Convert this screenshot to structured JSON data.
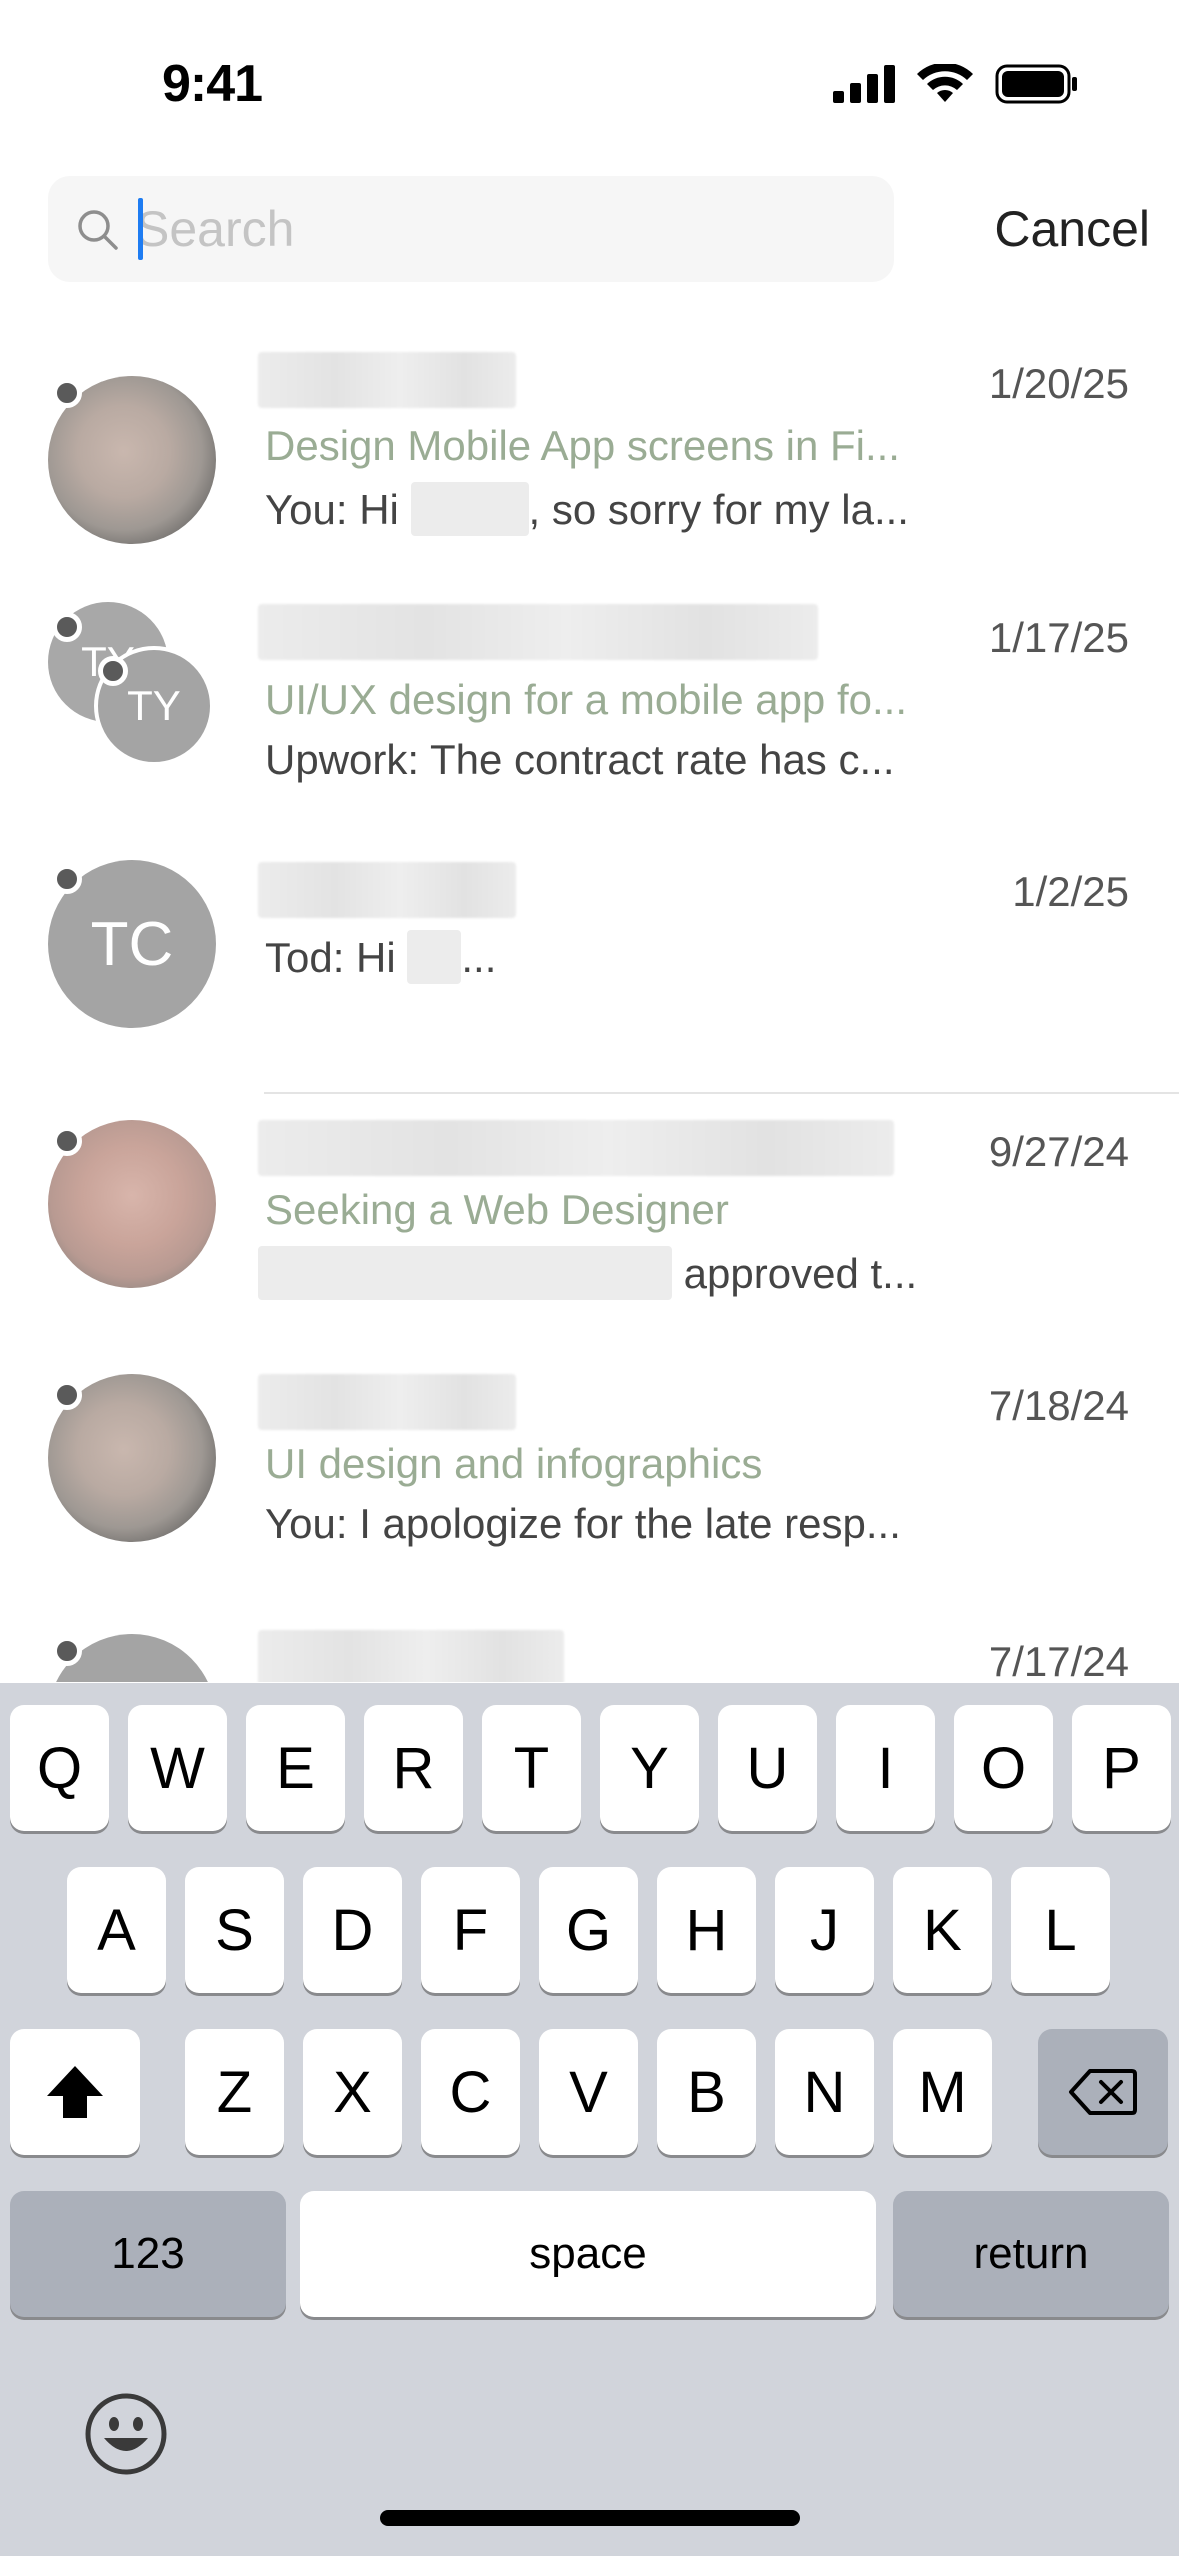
{
  "status_bar": {
    "time": "9:41"
  },
  "search": {
    "placeholder": "Search",
    "value": "",
    "cancel_label": "Cancel"
  },
  "conversations": [
    {
      "date": "1/20/25",
      "job_title": "Design Mobile App screens in Fi...",
      "preview_prefix": "You: Hi",
      "preview_suffix": ", so sorry for my la..."
    },
    {
      "date": "1/17/25",
      "avatar_initials_back": "TY",
      "avatar_initials_front": "TY",
      "job_title": "UI/UX design for a mobile app fo...",
      "preview": "Upwork: The contract rate has c..."
    },
    {
      "date": "1/2/25",
      "avatar_initials": "TC",
      "preview_prefix": "Tod: Hi",
      "preview_suffix": "..."
    },
    {
      "date": "9/27/24",
      "job_title": "Seeking a Web Designer",
      "preview_suffix": "approved t..."
    },
    {
      "date": "7/18/24",
      "job_title": "UI design and infographics",
      "preview": "You: I apologize for the late resp..."
    },
    {
      "date": "7/17/24"
    }
  ],
  "keyboard": {
    "row1": [
      "Q",
      "W",
      "E",
      "R",
      "T",
      "Y",
      "U",
      "I",
      "O",
      "P"
    ],
    "row2": [
      "A",
      "S",
      "D",
      "F",
      "G",
      "H",
      "J",
      "K",
      "L"
    ],
    "row3": [
      "Z",
      "X",
      "C",
      "V",
      "B",
      "N",
      "M"
    ],
    "numbers_label": "123",
    "space_label": "space",
    "return_label": "return"
  }
}
